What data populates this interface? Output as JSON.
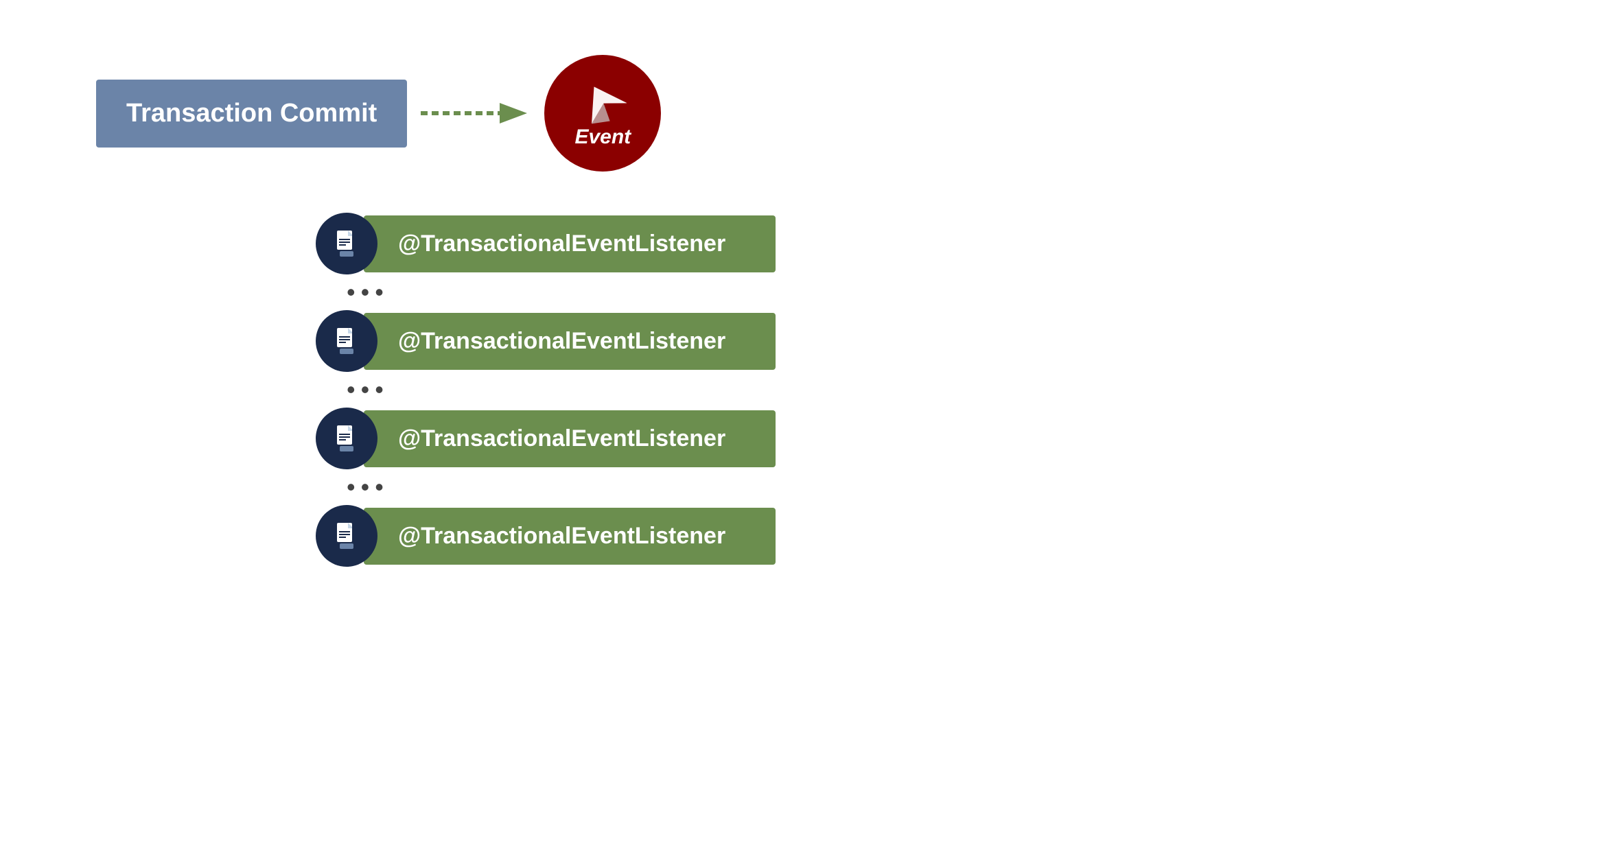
{
  "diagram": {
    "transaction_commit_label": "Transaction Commit",
    "event_label": "Event",
    "listeners": [
      {
        "label": "@TransactionalEventListener"
      },
      {
        "label": "@TransactionalEventListener"
      },
      {
        "label": "@TransactionalEventListener"
      },
      {
        "label": "@TransactionalEventListener"
      }
    ],
    "dots": "•••",
    "colors": {
      "transaction_box_bg": "#6b84a8",
      "event_circle_bg": "#8b0000",
      "listener_icon_bg": "#1a2a4a",
      "listener_bar_bg": "#6b8e4e",
      "arrow_color": "#6b8e4e"
    }
  }
}
